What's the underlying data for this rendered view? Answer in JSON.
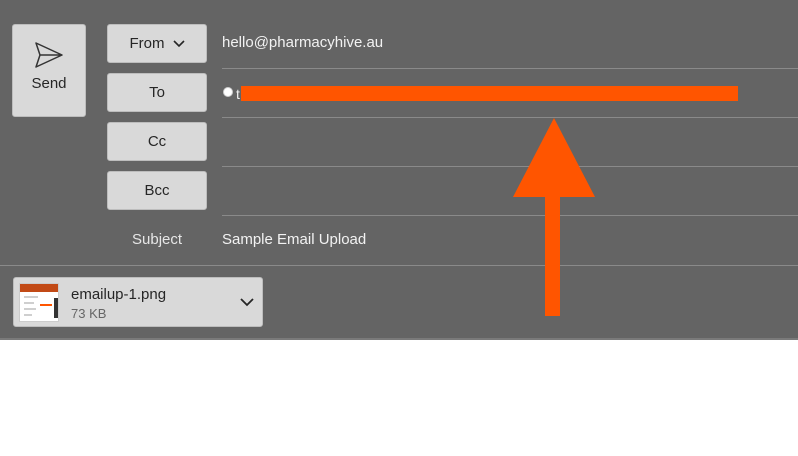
{
  "send": {
    "label": "Send",
    "icon": "send-icon"
  },
  "header": {
    "from_label": "From",
    "to_label": "To",
    "cc_label": "Cc",
    "bcc_label": "Bcc",
    "subject_label": "Subject"
  },
  "fields": {
    "from_value": "hello@pharmacyhive.au",
    "to_value": "t",
    "cc_value": "",
    "bcc_value": "",
    "subject_value": "Sample Email Upload"
  },
  "attachment": {
    "name": "emailup-1.png",
    "size": "73 KB"
  },
  "colors": {
    "annotation": "#ff5500",
    "panel": "#646464",
    "button": "#d9d9d9"
  }
}
